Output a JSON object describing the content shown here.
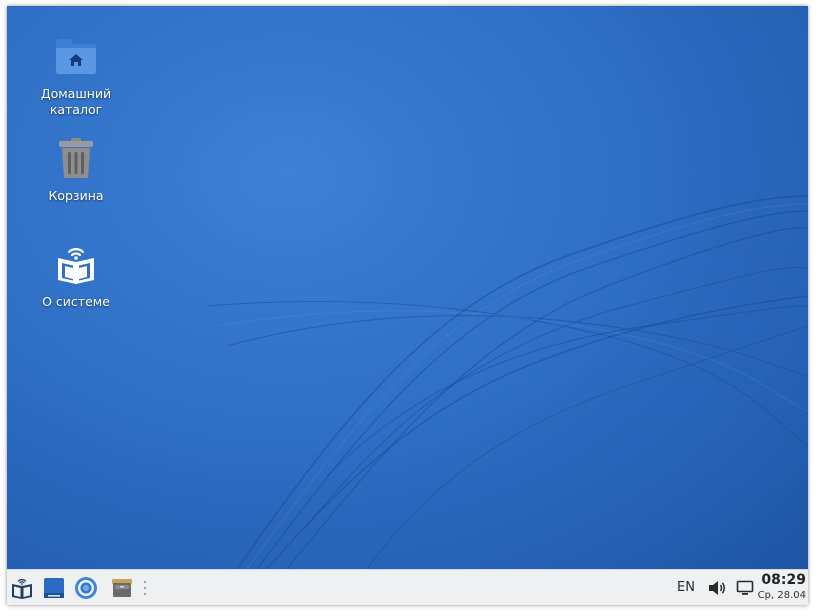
{
  "desktop": {
    "background_color": "#2f6fc6",
    "icons": [
      {
        "label": "Домашний\nкаталог",
        "icon": "home-folder-icon"
      },
      {
        "label": "Корзина",
        "icon": "trash-icon"
      },
      {
        "label": "О системе",
        "icon": "about-system-icon"
      }
    ]
  },
  "taskbar": {
    "launchers": [
      {
        "name": "start-menu",
        "icon": "book-logo-icon"
      },
      {
        "name": "show-desktop",
        "icon": "desktop-icon"
      },
      {
        "name": "browser",
        "icon": "browser-icon"
      },
      {
        "name": "file-manager",
        "icon": "file-cabinet-icon"
      }
    ],
    "keyboard_layout": "EN",
    "volume_icon": "speaker-icon",
    "notification_icon": "monitor-icon",
    "clock": {
      "time": "08:29",
      "date": "Ср, 28.04"
    }
  }
}
